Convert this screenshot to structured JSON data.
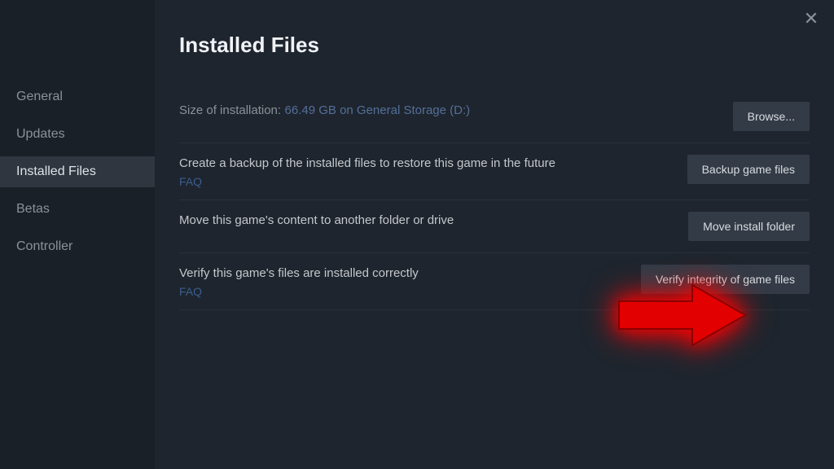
{
  "sidebar": {
    "items": [
      {
        "label": "General",
        "active": false
      },
      {
        "label": "Updates",
        "active": false
      },
      {
        "label": "Installed Files",
        "active": true
      },
      {
        "label": "Betas",
        "active": false
      },
      {
        "label": "Controller",
        "active": false
      }
    ]
  },
  "header": {
    "title": "Installed Files"
  },
  "rows": {
    "size": {
      "label": "Size of installation:",
      "value": "66.49 GB on General Storage (D:)",
      "button": "Browse..."
    },
    "backup": {
      "desc": "Create a backup of the installed files to restore this game in the future",
      "faq": "FAQ",
      "button": "Backup game files"
    },
    "move": {
      "desc": "Move this game's content to another folder or drive",
      "button": "Move install folder"
    },
    "verify": {
      "desc": "Verify this game's files are installed correctly",
      "faq": "FAQ",
      "button": "Verify integrity of game files"
    }
  },
  "closeGlyph": "✕"
}
